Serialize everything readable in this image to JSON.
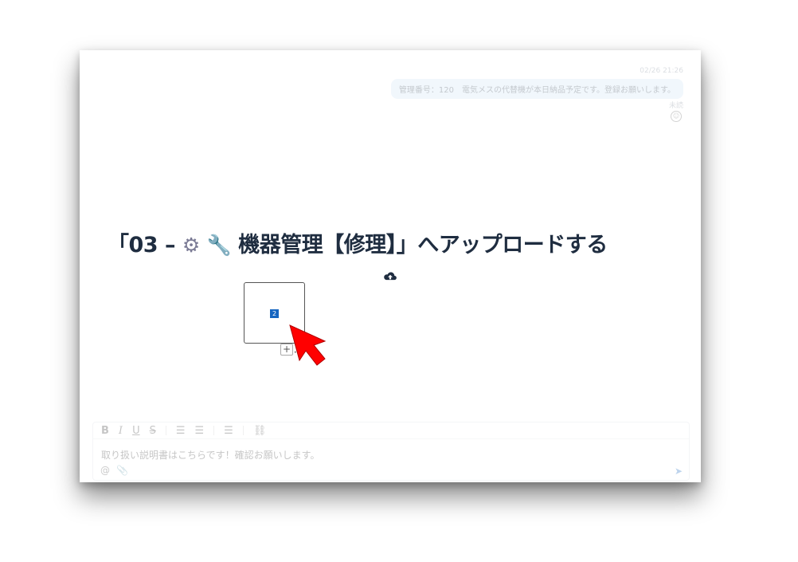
{
  "chat": {
    "message": {
      "time": "02/26 21:26",
      "text": "管理番号：120　電気メスの代替機が本日納品予定です。登録お願いします。",
      "status": "未読"
    }
  },
  "overlay": {
    "heading_prefix": "「03 –",
    "heading_suffix": "機器管理【修理】」へアップロードする",
    "heading_icons": [
      "gear-icon",
      "wrench-icon"
    ],
    "upload_icon": "cloud-upload-icon",
    "file_count_badge": "2",
    "add_label": "+",
    "cursor_color": "#ff0000"
  },
  "composer": {
    "toolbar": {
      "bold": "B",
      "italic": "I",
      "underline": "U",
      "strike": "S"
    },
    "text": "取り扱い説明書はこちらです！確認お願いします。",
    "mention_icon": "@",
    "send_color": "#1565c0"
  },
  "colors": {
    "bubble": "#cfe3f7",
    "heading": "#1f2d40",
    "badge": "#1565c0"
  }
}
